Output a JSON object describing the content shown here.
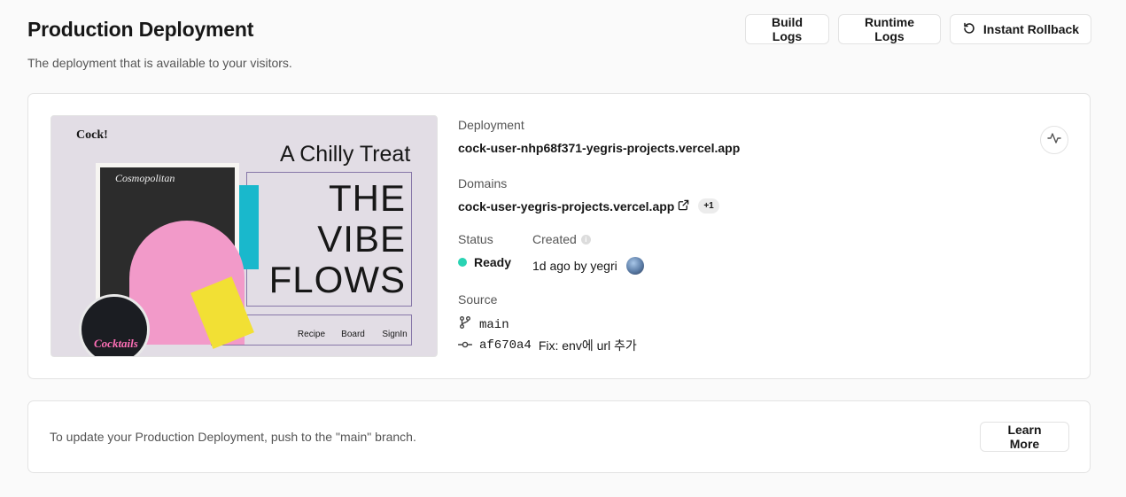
{
  "header": {
    "title": "Production Deployment",
    "subtitle": "The deployment that is available to your visitors.",
    "build_logs_label": "Build Logs",
    "runtime_logs_label": "Runtime Logs",
    "rollback_label": "Instant Rollback",
    "rollback_icon": "rollback-icon"
  },
  "preview": {
    "logo": "Cock!",
    "headline": "A Chilly Treat",
    "big_text": [
      "THE",
      "VIBE",
      "FLOWS"
    ],
    "board_title": "Cosmopolitan",
    "badge_text": "Cocktails",
    "nav": [
      "Recipe",
      "Board",
      "SignIn"
    ]
  },
  "deployment": {
    "label": "Deployment",
    "url": "cock-user-nhp68f371-yegris-projects.vercel.app",
    "domains_label": "Domains",
    "domain": "cock-user-yegris-projects.vercel.app",
    "domain_extra": "+1",
    "status_label": "Status",
    "status_value": "Ready",
    "status_color": "#29d3b3",
    "created_label": "Created",
    "created_value": "1d ago by yegri",
    "source_label": "Source",
    "branch": "main",
    "commit_hash": "af670a4",
    "commit_message": "Fix: env에 url 추가"
  },
  "hint": {
    "text": "To update your Production Deployment, push to the \"main\" branch.",
    "learn_more_label": "Learn More"
  }
}
